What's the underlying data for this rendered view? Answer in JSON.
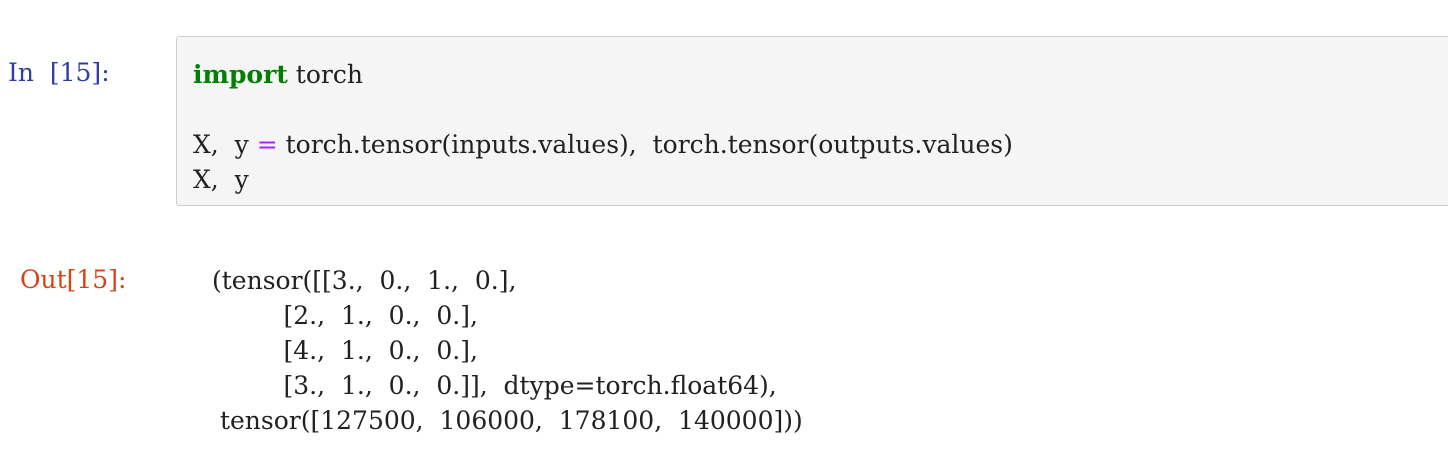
{
  "cell": {
    "in_prompt": "In  [15]:",
    "out_prompt": "Out[15]:",
    "code_lines": {
      "line1": {
        "keyword": "import",
        "rest": " torch"
      },
      "line2": "",
      "line3": {
        "before_op": "X,  y ",
        "op": "=",
        "after_op": " torch.tensor(inputs.values),  torch.tensor(outputs.values)"
      },
      "line4": "X,  y"
    },
    "output_lines": [
      "(tensor([[3.,  0.,  1.,  0.],",
      "         [2.,  1.,  0.,  0.],",
      "         [4.,  1.,  0.,  0.],",
      "         [3.,  1.,  0.,  0.]],  dtype=torch.float64),",
      " tensor([127500,  106000,  178100,  140000]))"
    ]
  }
}
